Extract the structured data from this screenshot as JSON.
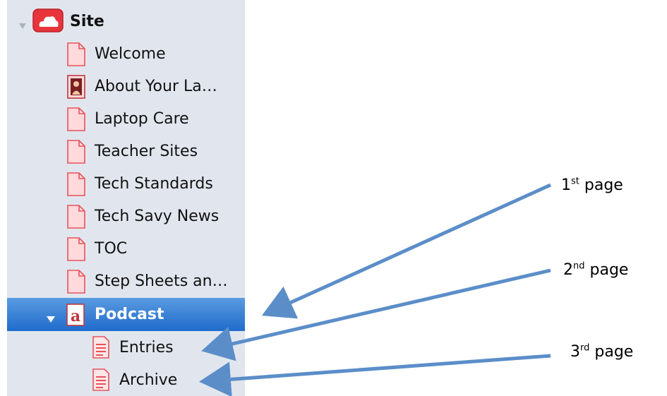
{
  "sidebar": {
    "root": {
      "label": "Site",
      "icon": "cloud-site-icon"
    },
    "pages": [
      {
        "label": "Welcome",
        "icon": "page-icon"
      },
      {
        "label": "About Your La…",
        "icon": "person-page-icon"
      },
      {
        "label": "Laptop Care",
        "icon": "page-icon"
      },
      {
        "label": "Teacher Sites",
        "icon": "page-icon"
      },
      {
        "label": "Tech Standards",
        "icon": "page-icon"
      },
      {
        "label": "Tech Savy News",
        "icon": "page-icon"
      },
      {
        "label": "TOC",
        "icon": "page-icon"
      },
      {
        "label": "Step Sheets an…",
        "icon": "page-icon"
      }
    ],
    "selected": {
      "label": "Podcast",
      "icon": "podcast-page-icon"
    },
    "children": [
      {
        "label": "Entries",
        "icon": "document-icon"
      },
      {
        "label": "Archive",
        "icon": "document-icon"
      }
    ]
  },
  "annotations": [
    {
      "num": "1",
      "suffix": "st",
      "text": "page"
    },
    {
      "num": "2",
      "suffix": "nd",
      "text": "page"
    },
    {
      "num": "3",
      "suffix": "rd",
      "text": "page"
    }
  ],
  "colors": {
    "sidebar_bg": "#e1e6ee",
    "selection": "#2f7ad6",
    "arrow": "#5b8ec9",
    "page_icon": "#e8525b"
  }
}
